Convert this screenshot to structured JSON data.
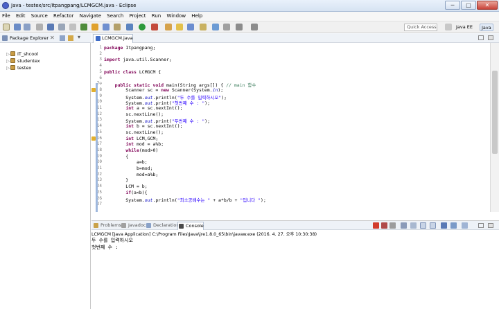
{
  "window": {
    "title": "Java - testex/src/Itpangpang/LCMGCM.java - Eclipse",
    "controls": [
      "─",
      "□",
      "✕"
    ]
  },
  "menu": [
    "File",
    "Edit",
    "Source",
    "Refactor",
    "Navigate",
    "Search",
    "Project",
    "Run",
    "Window",
    "Help"
  ],
  "toolbar": {
    "quick_access_placeholder": "Quick Access",
    "perspectives": [
      "Java EE",
      "Java"
    ]
  },
  "package_explorer": {
    "title": "Package Explorer",
    "projects": [
      "IT_shcool",
      "studentex",
      "testex"
    ]
  },
  "editor": {
    "tab_label": "LCMGCM.java",
    "lines": [
      {
        "n": "1",
        "segs": [
          {
            "c": "kw",
            "t": "package"
          },
          {
            "c": "",
            "t": " Itpangpang;"
          }
        ]
      },
      {
        "n": "2",
        "segs": []
      },
      {
        "n": "3",
        "segs": [
          {
            "c": "kw",
            "t": "import"
          },
          {
            "c": "",
            "t": " java.util.Scanner;"
          }
        ]
      },
      {
        "n": "4",
        "segs": []
      },
      {
        "n": "5",
        "segs": [
          {
            "c": "kw",
            "t": "public class"
          },
          {
            "c": "",
            "t": " LCMGCM {"
          }
        ]
      },
      {
        "n": "6",
        "segs": []
      },
      {
        "n": "7⊖",
        "segs": [
          {
            "c": "",
            "t": "    "
          },
          {
            "c": "kw",
            "t": "public static void"
          },
          {
            "c": "",
            "t": " main(String args[]) { "
          },
          {
            "c": "cm",
            "t": "// main 함수"
          }
        ]
      },
      {
        "n": "8",
        "segs": [
          {
            "c": "",
            "t": "        Scanner sc = "
          },
          {
            "c": "kw",
            "t": "new"
          },
          {
            "c": "",
            "t": " Scanner(System."
          },
          {
            "c": "fd it",
            "t": "in"
          },
          {
            "c": "",
            "t": ");"
          }
        ]
      },
      {
        "n": "9",
        "segs": [
          {
            "c": "",
            "t": "        System."
          },
          {
            "c": "fd it",
            "t": "out"
          },
          {
            "c": "",
            "t": ".println("
          },
          {
            "c": "st",
            "t": "\"두 수를 입력하시오\""
          },
          {
            "c": "",
            "t": ");"
          }
        ]
      },
      {
        "n": "10",
        "segs": [
          {
            "c": "",
            "t": "        System."
          },
          {
            "c": "fd it",
            "t": "out"
          },
          {
            "c": "",
            "t": ".print("
          },
          {
            "c": "st",
            "t": "\"첫번째 수 : \""
          },
          {
            "c": "",
            "t": ");"
          }
        ]
      },
      {
        "n": "11",
        "segs": [
          {
            "c": "",
            "t": "        "
          },
          {
            "c": "kw",
            "t": "int"
          },
          {
            "c": "",
            "t": " a = sc.nextInt();"
          }
        ]
      },
      {
        "n": "12",
        "segs": [
          {
            "c": "",
            "t": "        sc.nextLine();"
          }
        ]
      },
      {
        "n": "13",
        "segs": [
          {
            "c": "",
            "t": "        System."
          },
          {
            "c": "fd it",
            "t": "out"
          },
          {
            "c": "",
            "t": ".print("
          },
          {
            "c": "st",
            "t": "\"두번째 수 : \""
          },
          {
            "c": "",
            "t": ");"
          }
        ]
      },
      {
        "n": "14",
        "segs": [
          {
            "c": "",
            "t": "        "
          },
          {
            "c": "kw",
            "t": "int"
          },
          {
            "c": "",
            "t": " b = sc.nextInt();"
          }
        ]
      },
      {
        "n": "15",
        "segs": [
          {
            "c": "",
            "t": "        sc.nextLine();"
          }
        ]
      },
      {
        "n": "16",
        "segs": [
          {
            "c": "",
            "t": "        "
          },
          {
            "c": "kw",
            "t": "int"
          },
          {
            "c": "",
            "t": " LCM,GCM;"
          }
        ]
      },
      {
        "n": "17",
        "segs": [
          {
            "c": "",
            "t": "        "
          },
          {
            "c": "kw",
            "t": "int"
          },
          {
            "c": "",
            "t": " mod = a%b;"
          }
        ]
      },
      {
        "n": "18",
        "segs": [
          {
            "c": "",
            "t": "        "
          },
          {
            "c": "kw",
            "t": "while"
          },
          {
            "c": "",
            "t": "(mod>0)"
          }
        ]
      },
      {
        "n": "19",
        "segs": [
          {
            "c": "",
            "t": "        {"
          }
        ]
      },
      {
        "n": "20",
        "segs": [
          {
            "c": "",
            "t": "            a=b;"
          }
        ]
      },
      {
        "n": "21",
        "segs": [
          {
            "c": "",
            "t": "            b=mod;"
          }
        ]
      },
      {
        "n": "22",
        "segs": [
          {
            "c": "",
            "t": "            mod=a%b;"
          }
        ]
      },
      {
        "n": "23",
        "segs": [
          {
            "c": "",
            "t": "        }"
          }
        ]
      },
      {
        "n": "24",
        "segs": [
          {
            "c": "",
            "t": "        LCM = b;"
          }
        ]
      },
      {
        "n": "25",
        "segs": [
          {
            "c": "",
            "t": "        "
          },
          {
            "c": "kw",
            "t": "if"
          },
          {
            "c": "",
            "t": "(a<b){"
          }
        ]
      },
      {
        "n": "26",
        "segs": [
          {
            "c": "",
            "t": "        System."
          },
          {
            "c": "fd it",
            "t": "out"
          },
          {
            "c": "",
            "t": ".println("
          },
          {
            "c": "st",
            "t": "\"최소공배수는 \""
          },
          {
            "c": "",
            "t": " + a*b/b + "
          },
          {
            "c": "st",
            "t": "\"입니다 \""
          },
          {
            "c": "",
            "t": ");"
          }
        ]
      },
      {
        "n": "27",
        "segs": []
      }
    ]
  },
  "bottom_panel": {
    "tabs": [
      "Problems",
      "Javadoc",
      "Declaration",
      "Console"
    ],
    "active_tab": "Console",
    "console_path": "LCMGCM [Java Application] C:\\Program Files\\Java\\jre1.8.0_65\\bin\\javaw.exe (2016. 4. 27. 오후 10:30:38)",
    "output": [
      "두 수를 입력하시오",
      "첫번째 수 : "
    ]
  },
  "colors": {
    "keyword": "#7f0055",
    "string": "#2a00ff",
    "comment": "#3f7f5f",
    "field": "#0000c0"
  }
}
